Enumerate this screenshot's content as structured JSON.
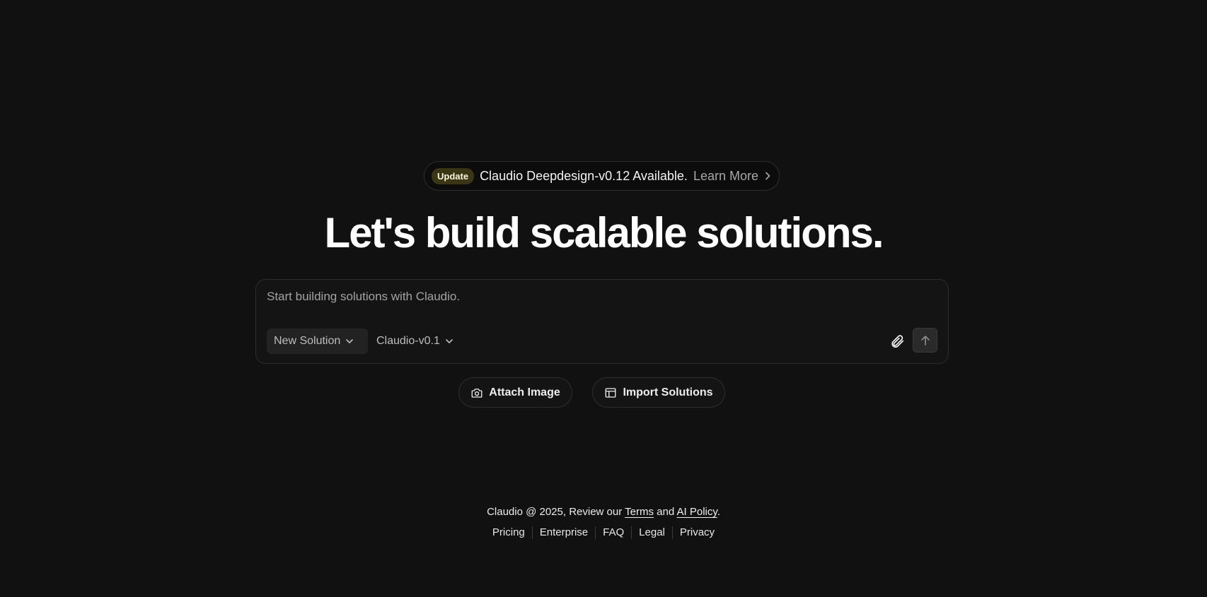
{
  "announcement": {
    "badge": "Update",
    "message": "Claudio Deepdesign-v0.12 Available.",
    "link_label": "Learn More"
  },
  "headline": "Let's build scalable solutions.",
  "prompt": {
    "placeholder": "Start building solutions with Claudio.",
    "value": "",
    "solution_selector": "New Solution",
    "model_selector": "Claudio-v0.1"
  },
  "actions": {
    "attach_image": "Attach Image",
    "import_solutions": "Import Solutions"
  },
  "footer": {
    "prefix": "Claudio @ 2025, Review our ",
    "terms": "Terms",
    "and": " and ",
    "ai_policy": "AI Policy",
    "suffix": ".",
    "links": [
      "Pricing",
      "Enterprise",
      "FAQ",
      "Legal",
      "Privacy"
    ]
  },
  "icons": {
    "chevron_right": "chevron-right-icon",
    "chevron_down": "chevron-down-icon",
    "paperclip": "paperclip-icon",
    "arrow_up": "arrow-up-icon",
    "camera": "camera-icon",
    "layout": "layout-icon"
  },
  "colors": {
    "background": "#111111",
    "badge_bg": "#3a3615",
    "muted_text": "#a8a8a8"
  }
}
